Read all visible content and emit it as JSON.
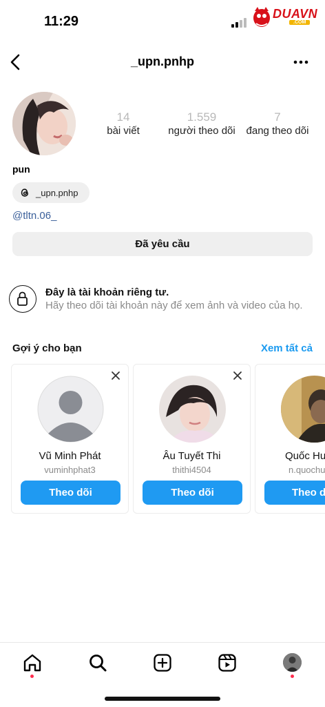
{
  "status_bar": {
    "time": "11:29",
    "brand": "DUAVN",
    "brand_sub": ".COM"
  },
  "header": {
    "username": "_upn.pnhp",
    "back_icon": "chevron-left-icon",
    "more_icon": "ellipsis-icon"
  },
  "profile": {
    "name": "pun",
    "stats": [
      {
        "value": "14",
        "label": "bài viết"
      },
      {
        "value": "1.559",
        "label": "người theo dõi"
      },
      {
        "value": "7",
        "label": "đang theo dõi"
      }
    ],
    "threads_handle": "_upn.pnhp",
    "bio_link": "@tltn.06_",
    "requested_label": "Đã yêu cầu"
  },
  "private_notice": {
    "title": "Đây là tài khoản riêng tư.",
    "description": "Hãy theo dõi tài khoản này để xem ảnh và video của họ."
  },
  "suggestions": {
    "title": "Gợi ý cho bạn",
    "see_all": "Xem tất cả",
    "cards": [
      {
        "name": "Vũ Minh Phát",
        "username": "vuminhphat3",
        "follow": "Theo dõi"
      },
      {
        "name": "Âu Tuyết Thi",
        "username": "thithi4504",
        "follow": "Theo dõi"
      },
      {
        "name": "Quốc Hu",
        "username": "n.quochu",
        "follow": "Theo d"
      }
    ]
  },
  "colors": {
    "accent": "#1f9af2",
    "link": "#3a5f9a",
    "notification_dot": "#ff2d4e"
  }
}
